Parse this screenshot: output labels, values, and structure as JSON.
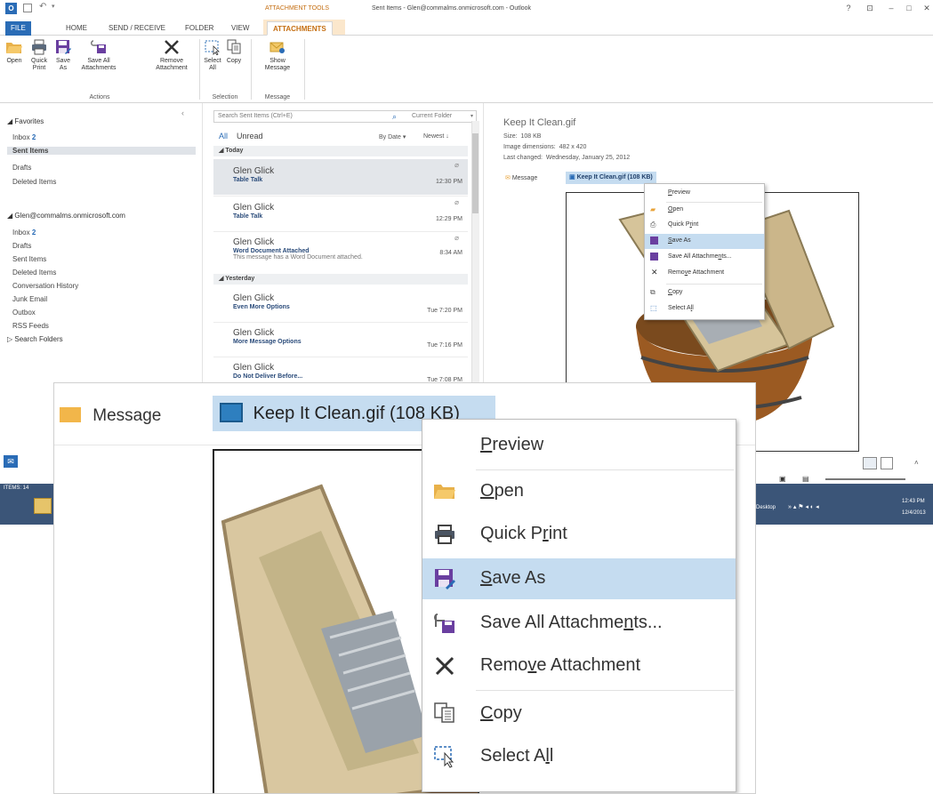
{
  "window": {
    "title": "Sent Items - Glen@commalms.onmicrosoft.com - Outlook",
    "context_tab_group": "ATTACHMENT TOOLS",
    "controls": {
      "help": "?",
      "restore": "⊡",
      "minimize": "–",
      "maximize": "□",
      "close": "✕"
    }
  },
  "tabs": [
    {
      "label": "FILE"
    },
    {
      "label": "HOME"
    },
    {
      "label": "SEND / RECEIVE"
    },
    {
      "label": "FOLDER"
    },
    {
      "label": "VIEW"
    },
    {
      "label": "ATTACHMENTS"
    }
  ],
  "ribbon": {
    "buttons": {
      "open": "Open",
      "quick_print_1": "Quick",
      "quick_print_2": "Print",
      "save_as_1": "Save",
      "save_as_2": "As",
      "save_all_1": "Save All",
      "save_all_2": "Attachments",
      "remove_1": "Remove",
      "remove_2": "Attachment",
      "select_all_1": "Select",
      "select_all_2": "All",
      "copy": "Copy",
      "show_message_1": "Show",
      "show_message_2": "Message"
    },
    "groups": {
      "actions": "Actions",
      "selection": "Selection",
      "message": "Message"
    }
  },
  "folders": {
    "favorites_header": "◢ Favorites",
    "favorites": [
      {
        "label": "Inbox",
        "count": "2"
      },
      {
        "label": "Sent Items",
        "count": ""
      },
      {
        "label": "Drafts",
        "count": ""
      },
      {
        "label": "Deleted Items",
        "count": ""
      }
    ],
    "account_header": "◢ Glen@commalms.onmicrosoft.com",
    "account": [
      {
        "label": "Inbox",
        "count": "2"
      },
      {
        "label": "Drafts",
        "count": ""
      },
      {
        "label": "Sent Items",
        "count": ""
      },
      {
        "label": "Deleted Items",
        "count": ""
      },
      {
        "label": "Conversation History",
        "count": ""
      },
      {
        "label": "Junk Email",
        "count": ""
      },
      {
        "label": "Outbox",
        "count": ""
      },
      {
        "label": "RSS Feeds",
        "count": ""
      },
      {
        "label": "▷ Search Folders",
        "count": ""
      }
    ]
  },
  "message_list": {
    "search_placeholder": "Search Sent Items (Ctrl+E)",
    "scope": "Current Folder",
    "filter_all": "All",
    "filter_unread": "Unread",
    "sort_by": "By Date ▾",
    "sort_order": "Newest ↓",
    "groups": [
      {
        "label": "◢ Today",
        "messages": [
          {
            "from": "Glen Glick",
            "subject": "Table Talk",
            "preview": "",
            "time": "12:30 PM",
            "attachment": true
          },
          {
            "from": "Glen Glick",
            "subject": "Table Talk",
            "preview": "",
            "time": "12:29 PM",
            "attachment": true
          },
          {
            "from": "Glen Glick",
            "subject": "Word Document Attached",
            "preview": "This message has a Word Document attached.",
            "time": "8:34 AM",
            "attachment": true
          }
        ]
      },
      {
        "label": "◢ Yesterday",
        "messages": [
          {
            "from": "Glen Glick",
            "subject": "Even More Options",
            "preview": "",
            "time": "Tue 7:20 PM",
            "attachment": false
          },
          {
            "from": "Glen Glick",
            "subject": "More Message Options",
            "preview": "",
            "time": "Tue 7:16 PM",
            "attachment": false
          },
          {
            "from": "Glen Glick",
            "subject": "Do Not Deliver Before...",
            "preview": "",
            "time": "Tue 7:08 PM",
            "attachment": false
          }
        ]
      }
    ]
  },
  "reading_pane": {
    "filename": "Keep It Clean.gif",
    "size_label": "Size:",
    "size_value": "108 KB",
    "dims_label": "Image dimensions:",
    "dims_value": "482 x 420",
    "changed_label": "Last changed:",
    "changed_value": "Wednesday, January 25, 2012",
    "message_tab": "Message",
    "attachment_tab": "Keep It Clean.gif (108 KB)"
  },
  "context_menu": {
    "items": [
      {
        "id": "preview",
        "pre": "",
        "ul": "P",
        "post": "review",
        "icon": ""
      },
      {
        "id": "open",
        "pre": "",
        "ul": "O",
        "post": "pen",
        "icon": "folder-open-icon"
      },
      {
        "id": "quick_print",
        "pre": "Quick P",
        "ul": "r",
        "post": "int",
        "icon": "printer-icon"
      },
      {
        "id": "save_as",
        "pre": "",
        "ul": "S",
        "post": "ave As",
        "icon": "save-as-icon"
      },
      {
        "id": "save_all",
        "pre": "Save All Attachme",
        "ul": "n",
        "post": "ts...",
        "icon": "save-all-icon"
      },
      {
        "id": "remove",
        "pre": "Remo",
        "ul": "v",
        "post": "e Attachment",
        "icon": "remove-icon"
      },
      {
        "id": "copy",
        "pre": "",
        "ul": "C",
        "post": "opy",
        "icon": "copy-icon"
      },
      {
        "id": "select_all",
        "pre": "Select A",
        "ul": "l",
        "post": "l",
        "icon": "select-all-icon"
      }
    ],
    "highlighted": "save_as"
  },
  "taskbar": {
    "status_left": "ITEMS: 14",
    "desktop_label": "Desktop",
    "time": "12:43 PM",
    "date": "12/4/2013"
  },
  "colors": {
    "accent_blue": "#2a6cb6",
    "context_orange": "#c56f13",
    "menu_highlight": "#c5dcf0",
    "attachment_tab_bg": "#c5dcf0"
  }
}
